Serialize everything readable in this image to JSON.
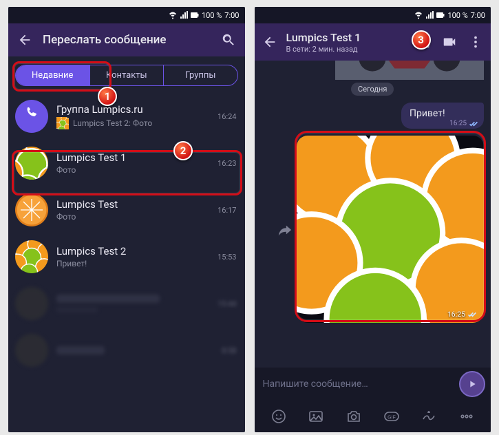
{
  "status": {
    "battery": "100 %",
    "time": "7:00"
  },
  "left": {
    "title": "Переслать сообщение",
    "tabs": {
      "recent": "Недавние",
      "contacts": "Контакты",
      "groups": "Группы"
    },
    "rows": [
      {
        "title": "Группа Lumpics.ru",
        "sub": "Lumpics Test 2: Фото",
        "time": "16:24"
      },
      {
        "title": "Lumpics Test 1",
        "sub": "Фото",
        "time": "16:23"
      },
      {
        "title": "Lumpics Test",
        "sub": "Фото",
        "time": "16:17"
      },
      {
        "title": "Lumpics Test 2",
        "sub": "Привет!",
        "time": "15:53"
      },
      {
        "title": "",
        "sub": "",
        "time": "15:44"
      },
      {
        "title": "",
        "sub": "",
        "time": "8:58"
      }
    ]
  },
  "right": {
    "title": "Lumpics Test 1",
    "presence": "В сети: 2 мин. назад",
    "day": "Сегодня",
    "bubble": {
      "text": "Привет!",
      "time": "16:25"
    },
    "photo_time": "16:25",
    "composer_placeholder": "Напишите сообщение…"
  },
  "callouts": {
    "c1": "1",
    "c2": "2",
    "c3": "3"
  }
}
